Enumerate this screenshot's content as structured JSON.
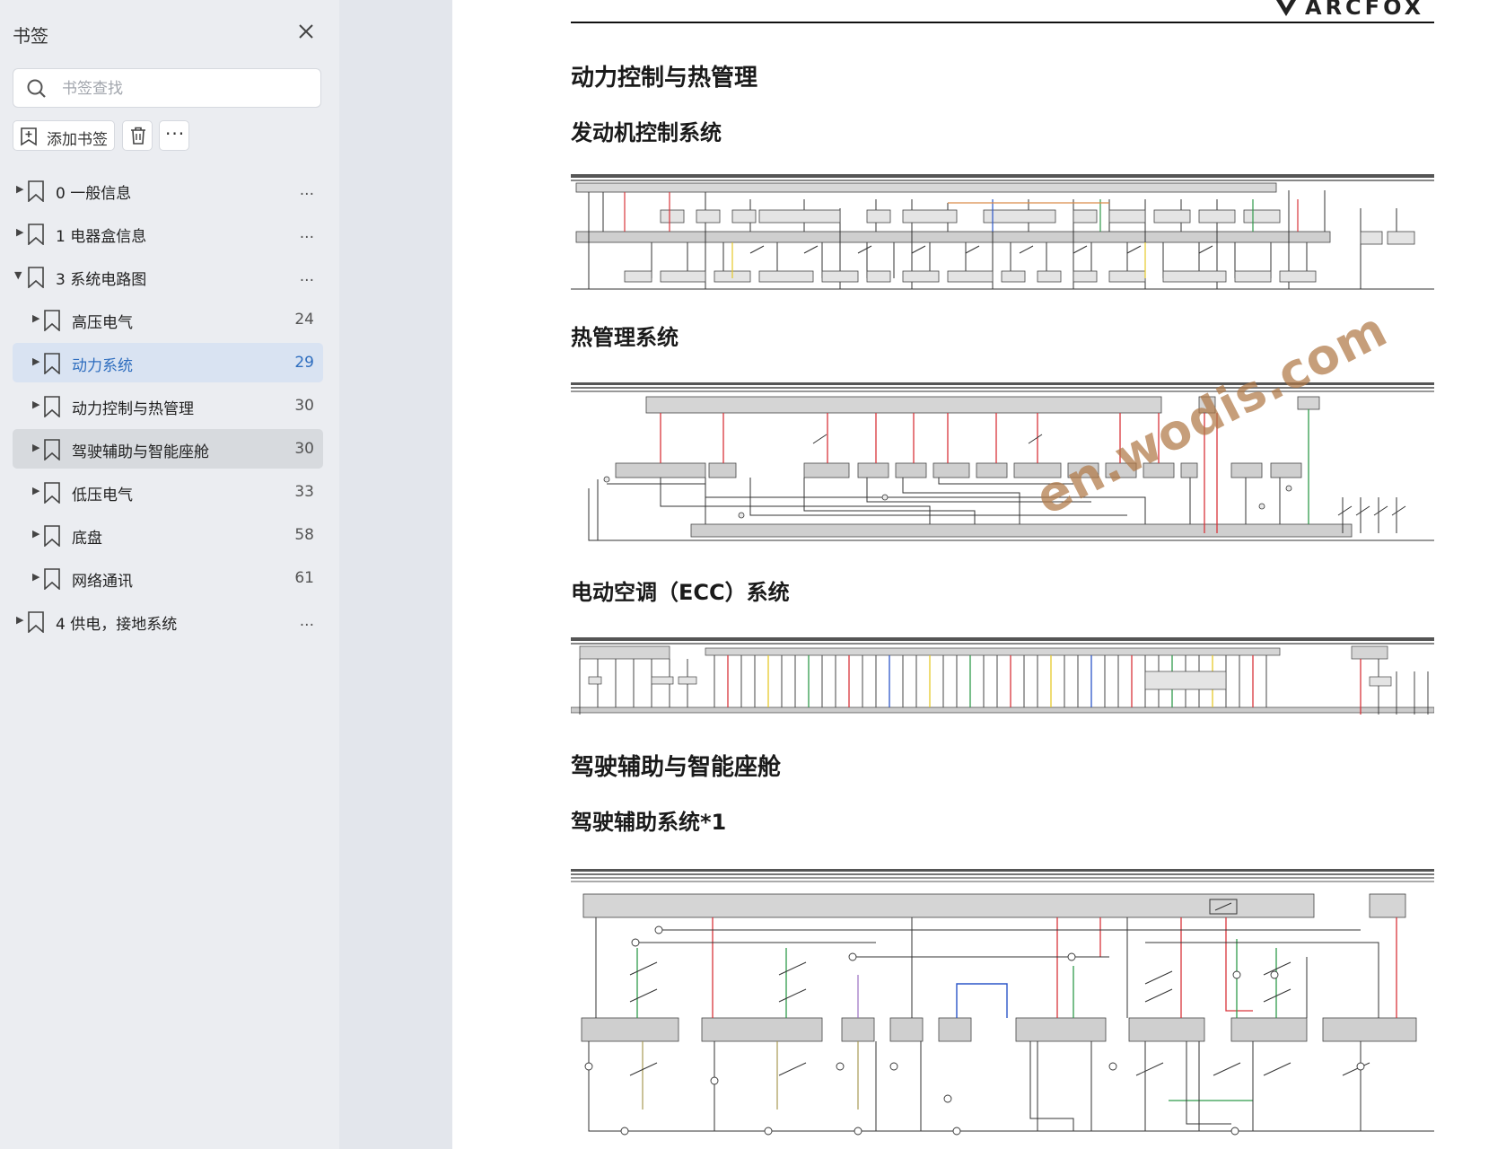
{
  "sidebar": {
    "title": "书签",
    "search_placeholder": "书签查找",
    "add_bookmark": "添加书签",
    "more_label": "···",
    "items": [
      {
        "label": "0 一般信息",
        "count": "...",
        "level": 0,
        "expanded": false
      },
      {
        "label": "1 电器盒信息",
        "count": "...",
        "level": 0,
        "expanded": false
      },
      {
        "label": "3 系统电路图",
        "count": "...",
        "level": 0,
        "expanded": true
      },
      {
        "label": "高压电气",
        "count": "24",
        "level": 1,
        "expanded": false
      },
      {
        "label": "动力系统",
        "count": "29",
        "level": 1,
        "expanded": false,
        "state": "selected"
      },
      {
        "label": "动力控制与热管理",
        "count": "30",
        "level": 1,
        "expanded": false
      },
      {
        "label": "驾驶辅助与智能座舱",
        "count": "30",
        "level": 1,
        "expanded": false,
        "state": "hover"
      },
      {
        "label": "低压电气",
        "count": "33",
        "level": 1,
        "expanded": false
      },
      {
        "label": "底盘",
        "count": "58",
        "level": 1,
        "expanded": false
      },
      {
        "label": "网络通讯",
        "count": "61",
        "level": 1,
        "expanded": false
      },
      {
        "label": "4 供电，接地系统",
        "count": "...",
        "level": 0,
        "expanded": false
      }
    ]
  },
  "document": {
    "brand": "ARCFOX",
    "section1_title": "动力控制与热管理",
    "section1_sub1": "发动机控制系统",
    "section1_sub2": "热管理系统",
    "section1_sub3": "电动空调（ECC）系统",
    "section2_title": "驾驶辅助与智能座舱",
    "section2_sub1": "驾驶辅助系统*1",
    "watermark": "en.wodis.com"
  },
  "colors": {
    "sidebar_bg": "#ebedf1",
    "selected_bg": "#d9e3f2",
    "selected_text": "#2f6ebf",
    "hover_bg": "#d7dade",
    "wire_red": "#d9343a",
    "wire_green": "#2f9a4a",
    "wire_blue": "#2c56c8",
    "wire_yellow": "#e6c929"
  }
}
